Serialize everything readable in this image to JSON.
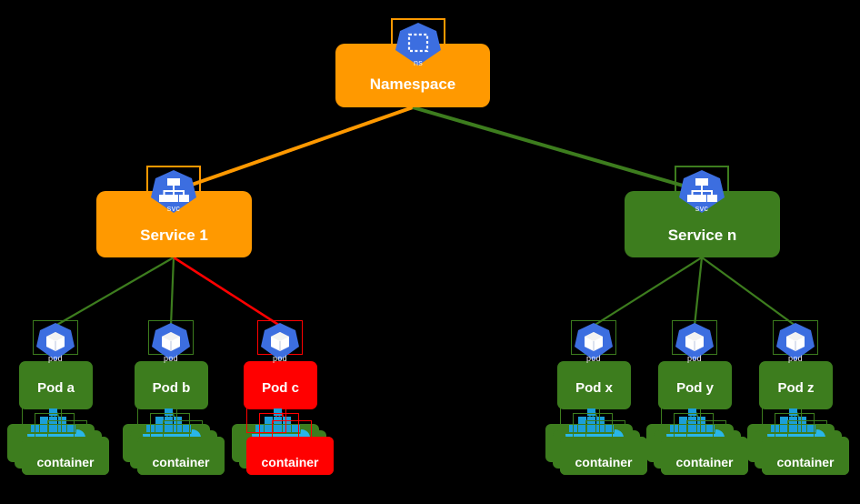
{
  "diagram": {
    "title": "Kubernetes namespace, services, pods and containers hierarchy",
    "background_color": "#000000",
    "palette": {
      "orange": "#ff9900",
      "green": "#3d7d1e",
      "red": "#ff0000",
      "k8s_blue": "#3c6ee0",
      "docker_blue": "#1b9fd8",
      "text": "#ffffff"
    }
  },
  "nodes": {
    "namespace": {
      "label": "Namespace",
      "icon": "k8s-namespace-icon",
      "icon_sublabel": "ns",
      "color": "#ff9900",
      "state": "normal"
    },
    "services": [
      {
        "id": "service-1",
        "label": "Service 1",
        "icon": "k8s-service-icon",
        "icon_sublabel": "svc",
        "color": "#ff9900",
        "state": "normal"
      },
      {
        "id": "service-n",
        "label": "Service n",
        "icon": "k8s-service-icon",
        "icon_sublabel": "svc",
        "color": "#3d7d1e",
        "state": "healthy"
      }
    ],
    "pods": [
      {
        "id": "pod-a",
        "label": "Pod a",
        "icon": "k8s-pod-icon",
        "icon_sublabel": "pod",
        "color": "#3d7d1e",
        "state": "healthy",
        "service": "service-1",
        "container": {
          "label": "container",
          "icon": "docker-whale-icon",
          "color": "#3d7d1e",
          "stack_count": 3
        }
      },
      {
        "id": "pod-b",
        "label": "Pod b",
        "icon": "k8s-pod-icon",
        "icon_sublabel": "pod",
        "color": "#3d7d1e",
        "state": "healthy",
        "service": "service-1",
        "container": {
          "label": "container",
          "icon": "docker-whale-icon",
          "color": "#3d7d1e",
          "stack_count": 3
        }
      },
      {
        "id": "pod-c",
        "label": "Pod c",
        "icon": "k8s-pod-icon",
        "icon_sublabel": "pod",
        "color": "#ff0000",
        "state": "failed",
        "service": "service-1",
        "container": {
          "label": "container",
          "icon": "docker-whale-icon",
          "color": "#ff0000",
          "stack_count": 3
        }
      },
      {
        "id": "pod-x",
        "label": "Pod x",
        "icon": "k8s-pod-icon",
        "icon_sublabel": "pod",
        "color": "#3d7d1e",
        "state": "healthy",
        "service": "service-n",
        "container": {
          "label": "container",
          "icon": "docker-whale-icon",
          "color": "#3d7d1e",
          "stack_count": 3
        }
      },
      {
        "id": "pod-y",
        "label": "Pod y",
        "icon": "k8s-pod-icon",
        "icon_sublabel": "pod",
        "color": "#3d7d1e",
        "state": "healthy",
        "service": "service-n",
        "container": {
          "label": "container",
          "icon": "docker-whale-icon",
          "color": "#3d7d1e",
          "stack_count": 3
        }
      },
      {
        "id": "pod-z",
        "label": "Pod z",
        "icon": "k8s-pod-icon",
        "icon_sublabel": "pod",
        "color": "#3d7d1e",
        "state": "healthy",
        "service": "service-n",
        "container": {
          "label": "container",
          "icon": "docker-whale-icon",
          "color": "#3d7d1e",
          "stack_count": 3
        }
      }
    ]
  },
  "edges": [
    {
      "from": "namespace",
      "to": "service-1",
      "color": "#ff9900",
      "width": 4
    },
    {
      "from": "namespace",
      "to": "service-n",
      "color": "#3d7d1e",
      "width": 4
    },
    {
      "from": "service-1",
      "to": "pod-a",
      "color": "#3d7d1e",
      "width": 2
    },
    {
      "from": "service-1",
      "to": "pod-b",
      "color": "#3d7d1e",
      "width": 2
    },
    {
      "from": "service-1",
      "to": "pod-c",
      "color": "#ff0000",
      "width": 2.4
    },
    {
      "from": "service-n",
      "to": "pod-x",
      "color": "#3d7d1e",
      "width": 2
    },
    {
      "from": "service-n",
      "to": "pod-y",
      "color": "#3d7d1e",
      "width": 2
    },
    {
      "from": "service-n",
      "to": "pod-z",
      "color": "#3d7d1e",
      "width": 2
    }
  ]
}
